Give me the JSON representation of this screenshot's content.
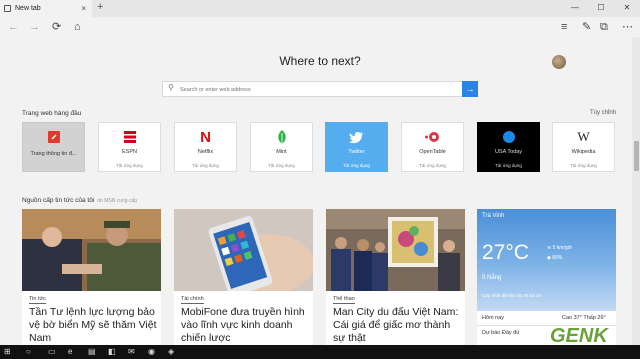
{
  "tab": {
    "title": "New tab",
    "close_icon": "×",
    "new_tab_icon": "+"
  },
  "window_controls": [
    "—",
    "☐",
    "✕"
  ],
  "nav": {
    "back_icon": "←",
    "forward_icon": "→",
    "refresh_icon": "⟳",
    "home_icon": "⌂",
    "hub_icon": "≡",
    "note_icon": "✎",
    "share_icon": "⧉",
    "more_icon": "⋯"
  },
  "page": {
    "title": "Where to next?",
    "search_placeholder": "Search or enter web address",
    "go_icon": "→",
    "search_icon": "⚲",
    "top_sites_label": "Trang web hàng đầu",
    "customize_label": "Tùy chỉnh",
    "news_label": "Nguồn cấp tin tức của tôi",
    "news_sub": "do MSN cung cấp"
  },
  "top_sites": [
    {
      "name": "Trang thông tin đ...",
      "hint": "",
      "logo": "msn",
      "color": "#e03a2f"
    },
    {
      "name": "ESPN",
      "hint": "Tải ứng dụng",
      "logo": "espn",
      "color": "#d0021b"
    },
    {
      "name": "Netflix",
      "hint": "Tải ứng dụng",
      "logo": "N",
      "color": "#e50914"
    },
    {
      "name": "Mint",
      "hint": "Tải ứng dụng",
      "logo": "mint",
      "color": "#2fb44a"
    },
    {
      "name": "Twitter",
      "hint": "Tải ứng dụng",
      "logo": "twitter",
      "color": "#ffffff"
    },
    {
      "name": "OpenTable",
      "hint": "Tải ứng dụng",
      "logo": "opentable",
      "color": "#da3743"
    },
    {
      "name": "USA Today",
      "hint": "Tải ứng dụng",
      "logo": "usatoday",
      "color": "#1e88e5"
    },
    {
      "name": "Wikipedia",
      "hint": "Tải ứng dụng",
      "logo": "W",
      "color": "#222222"
    }
  ],
  "news": [
    {
      "category": "Tin tức",
      "headline": "Tần Tư lệnh lực lượng bảo vệ bờ biển Mỹ sẽ thăm Việt Nam"
    },
    {
      "category": "Tài chính",
      "headline": "MobiFone đưa truyền hình vào lĩnh vực kinh doanh chiến lược"
    },
    {
      "category": "Thể thao",
      "headline": "Man City du đấu Việt Nam: Cái giá để giấc mơ thành sự thật"
    }
  ],
  "weather": {
    "location": "Trà Vinh",
    "temp": "27°C",
    "condition": "Ít Nắng",
    "wind": "5 km/giờ",
    "humidity": "80%",
    "updated": "Cập nhật dữ liệu lúc 06:54 SA",
    "today_label": "Hôm nay",
    "high_low": "Cao 37° Thấp 26°",
    "forecast_label": "Dự báo Đầy đủ"
  },
  "watermark": "GENK"
}
